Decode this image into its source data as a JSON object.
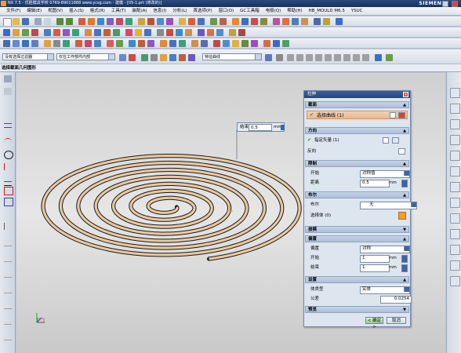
{
  "titlebar": {
    "text": "NX 7.5 - 优胜模具学校 0769-89011888 www.ycsg.com - 建模 - [05-1.prt (修改的)]",
    "brand": "SIEMENS"
  },
  "menu": [
    "文件(F)",
    "编辑(E)",
    "视图(V)",
    "插入(S)",
    "格式(R)",
    "工具(T)",
    "装配(A)",
    "信息(I)",
    "分析(L)",
    "首选项(P)",
    "窗口(O)",
    "GC工具箱",
    "电极(Q)",
    "帮助(H)",
    "HB_MOULD M6.5",
    "YSUC"
  ],
  "selection_bar": {
    "filter": "没有选择过滤器",
    "scope": "仅在工作部件内部",
    "curve_rule": "特征曲线"
  },
  "cue_line": "选择截面几何图形",
  "floating_input": {
    "label": "结束",
    "value": "0.5",
    "unit": "mm"
  },
  "dialog": {
    "title": "拉伸",
    "close": "×",
    "sections": {
      "section": "截面",
      "direction": "方向",
      "limits": "限制",
      "boolean": "布尔",
      "draft": "拔模",
      "offset": "偏置",
      "settings": "设置",
      "preview": "预览"
    },
    "select_curve": "选择曲线 (1)",
    "specify_vector": "指定矢量 (1)",
    "reverse": "反向",
    "start_label": "开始",
    "start_mode": "对称值",
    "distance_label": "距离",
    "distance_value": "0.5",
    "distance_unit": "mm",
    "boolean_label": "布尔",
    "boolean_value": "无",
    "select_body": "选择体 (0)",
    "offset_label": "偏置",
    "offset_mode": "对称",
    "offset_start_label": "开始",
    "offset_start_value": "1",
    "offset_end_label": "结束",
    "offset_end_value": "1",
    "offset_unit": "mm",
    "body_type_label": "体类型",
    "body_type_value": "实体",
    "tolerance_label": "公差",
    "tolerance_value": "0.0254",
    "ok": "< 确定 >",
    "cancel": "取消"
  },
  "colors": {
    "titlebar": "#1f3b6b",
    "canvas": "#d8d8d8",
    "highlight_section": "#efc39f",
    "spiral_fill": "#e8c8a0",
    "spiral_edge": "#1a1a1a"
  }
}
